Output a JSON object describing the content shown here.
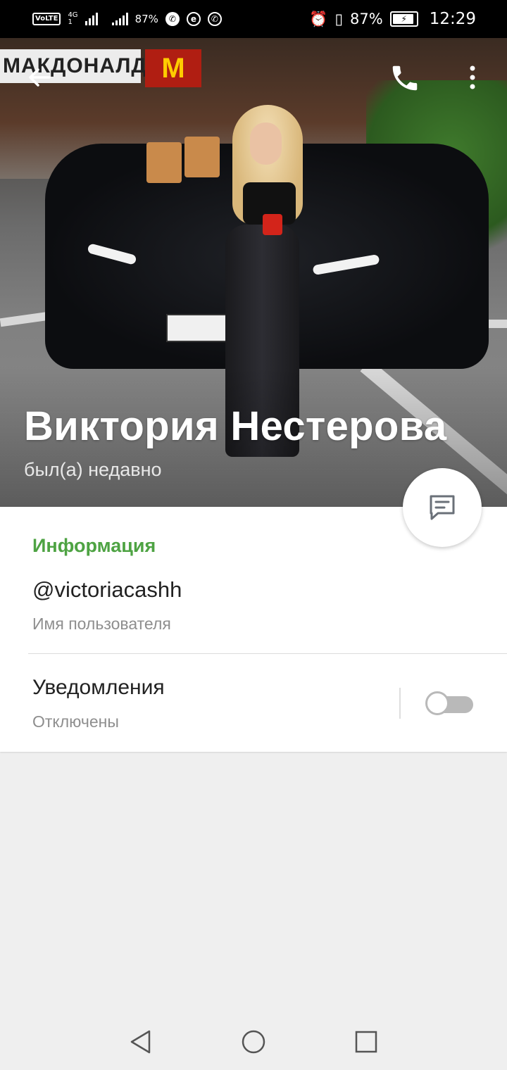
{
  "status_bar": {
    "volte": "VoLTE",
    "network": "4G",
    "network_sub": "1",
    "left_battery": "87%",
    "right_battery": "87%",
    "time": "12:29",
    "app_icon_letter": "e"
  },
  "header": {
    "background_sign": "МАКДОНАЛДС",
    "background_logo": "M",
    "name": "Виктория Нестерова",
    "status": "был(а) недавно"
  },
  "info": {
    "section_title": "Информация",
    "username": "@victoriacashh",
    "username_label": "Имя пользователя",
    "notifications_title": "Уведомления",
    "notifications_value": "Отключены",
    "notifications_enabled": false
  },
  "colors": {
    "accent": "#4ea343",
    "status_bar": "#000000",
    "background": "#efefef"
  },
  "icons": [
    "back-arrow-icon",
    "phone-icon",
    "more-vertical-icon",
    "message-icon",
    "nav-back-icon",
    "nav-home-icon",
    "nav-recents-icon"
  ]
}
